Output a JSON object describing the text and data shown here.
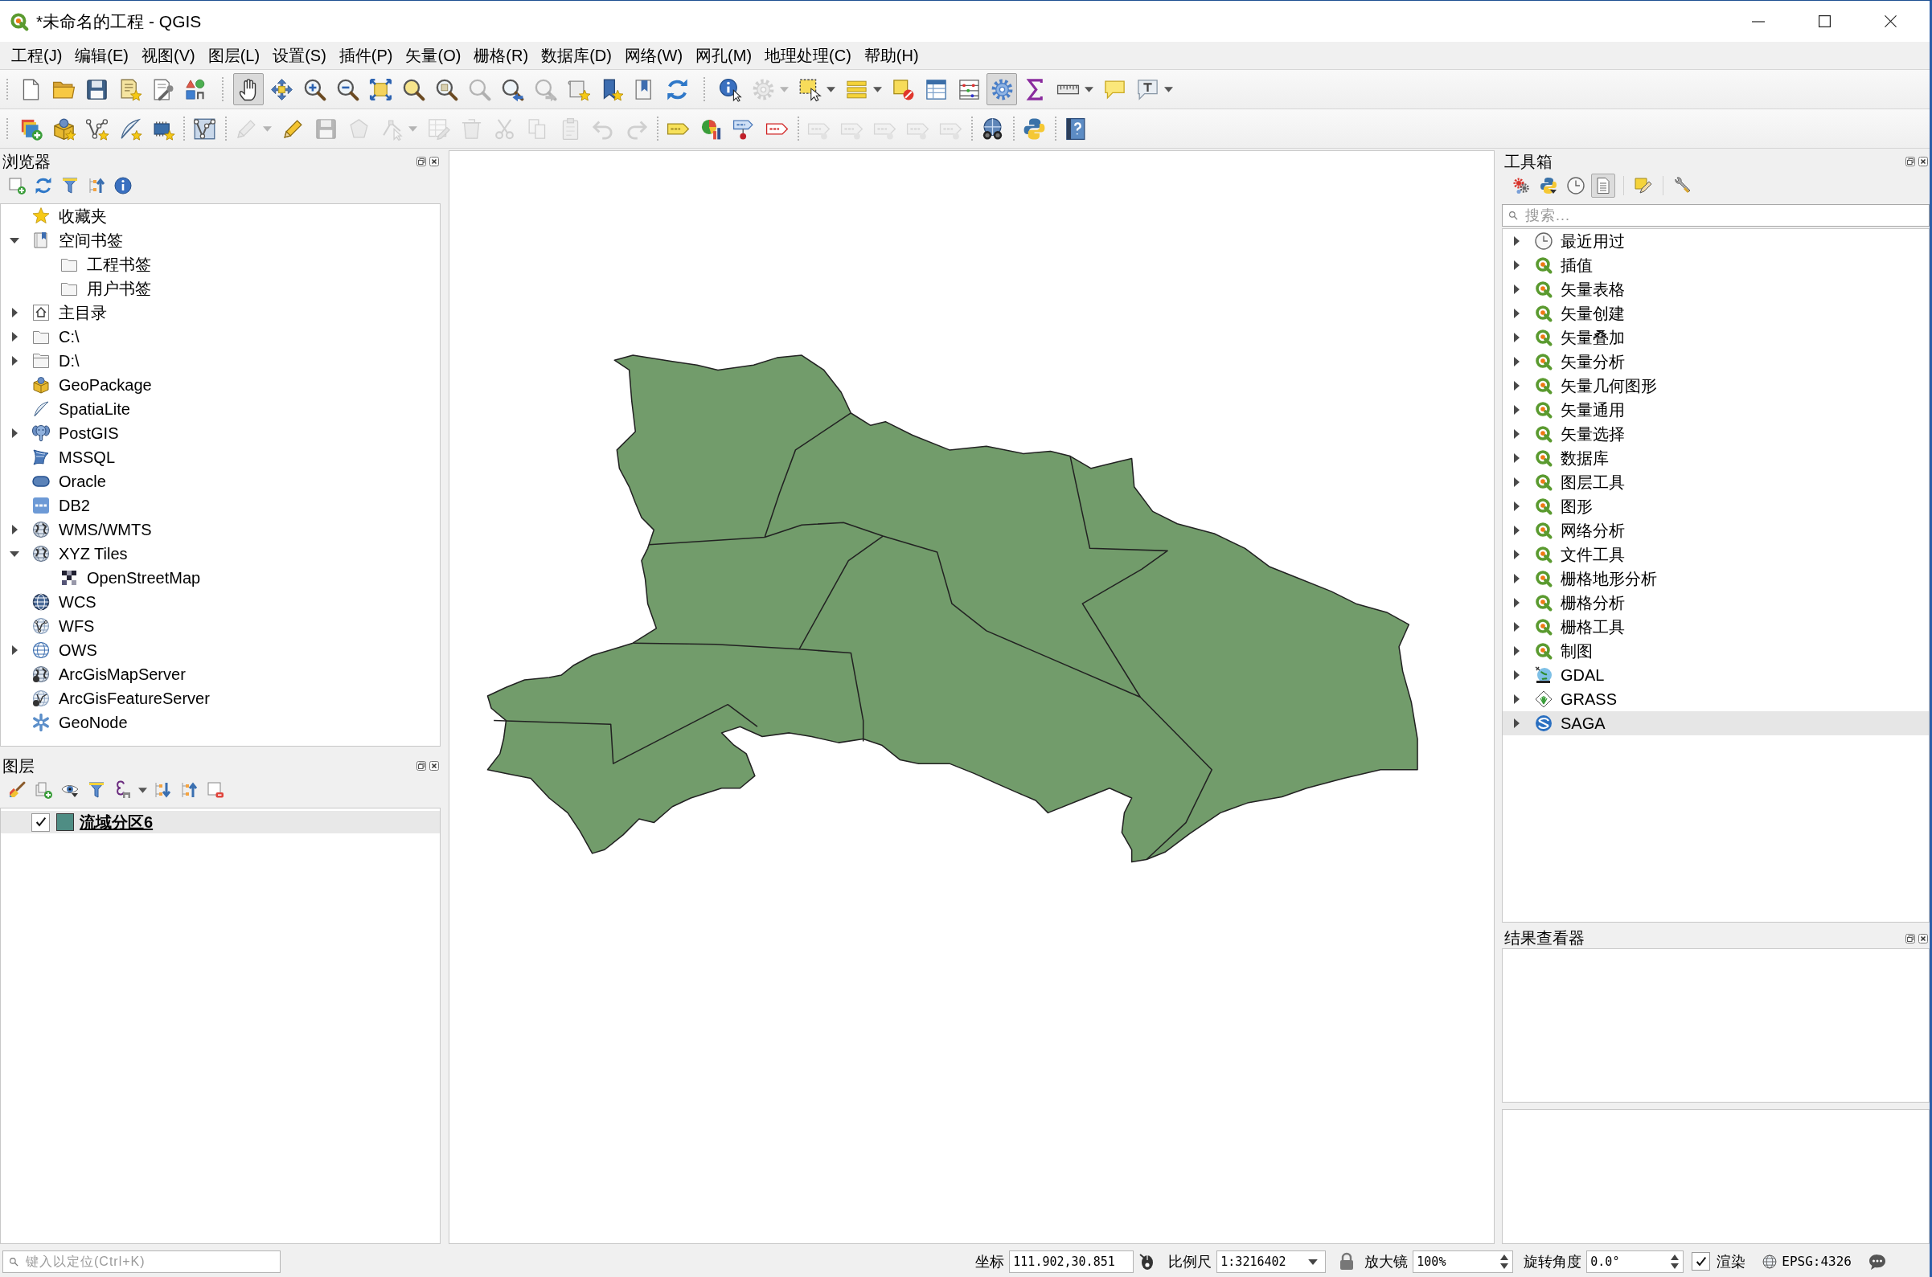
{
  "window": {
    "title": "*未命名的工程 - QGIS"
  },
  "menu": [
    "工程(J)",
    "编辑(E)",
    "视图(V)",
    "图层(L)",
    "设置(S)",
    "插件(P)",
    "矢量(O)",
    "栅格(R)",
    "数据库(D)",
    "网络(W)",
    "网孔(M)",
    "地理处理(C)",
    "帮助(H)"
  ],
  "toolbars": [
    {
      "groups": [
        [
          {
            "kind": "new",
            "selected": false,
            "disabled": false,
            "dropdown": false
          },
          {
            "kind": "open",
            "selected": false,
            "disabled": false,
            "dropdown": false
          },
          {
            "kind": "save",
            "selected": false,
            "disabled": false,
            "dropdown": false
          },
          {
            "kind": "layout-new",
            "selected": false,
            "disabled": false,
            "dropdown": false
          },
          {
            "kind": "layout-manager",
            "selected": false,
            "disabled": false,
            "dropdown": false
          },
          {
            "kind": "style",
            "selected": false,
            "disabled": false,
            "dropdown": false
          }
        ],
        [
          {
            "kind": "pan",
            "selected": true,
            "disabled": false,
            "dropdown": false
          },
          {
            "kind": "pan-select",
            "selected": false,
            "disabled": false,
            "dropdown": false
          },
          {
            "kind": "zoom-in",
            "selected": false,
            "disabled": false,
            "dropdown": false
          },
          {
            "kind": "zoom-out",
            "selected": false,
            "disabled": false,
            "dropdown": false
          },
          {
            "kind": "zoom-full",
            "selected": false,
            "disabled": false,
            "dropdown": false
          },
          {
            "kind": "zoom-selection",
            "selected": false,
            "disabled": false,
            "dropdown": false
          },
          {
            "kind": "zoom-layer",
            "selected": false,
            "disabled": false,
            "dropdown": false
          },
          {
            "kind": "zoom-native",
            "selected": false,
            "disabled": true,
            "dropdown": false
          },
          {
            "kind": "zoom-last",
            "selected": false,
            "disabled": false,
            "dropdown": false
          },
          {
            "kind": "zoom-next",
            "selected": false,
            "disabled": true,
            "dropdown": false
          },
          {
            "kind": "map-new",
            "selected": false,
            "disabled": false,
            "dropdown": false
          },
          {
            "kind": "bookmark-new",
            "selected": false,
            "disabled": false,
            "dropdown": false
          },
          {
            "kind": "bookmarks",
            "selected": false,
            "disabled": false,
            "dropdown": false
          },
          {
            "kind": "refresh",
            "selected": false,
            "disabled": false,
            "dropdown": false
          }
        ],
        [
          {
            "kind": "identify",
            "selected": false,
            "disabled": false,
            "dropdown": false
          },
          {
            "kind": "action",
            "selected": false,
            "disabled": true,
            "dropdown": true
          },
          {
            "kind": "select",
            "selected": false,
            "disabled": false,
            "dropdown": true
          },
          {
            "kind": "select-attr",
            "selected": false,
            "disabled": false,
            "dropdown": true
          },
          {
            "kind": "deselect",
            "selected": false,
            "disabled": false,
            "dropdown": false
          },
          {
            "kind": "table",
            "selected": false,
            "disabled": false,
            "dropdown": false
          },
          {
            "kind": "stats",
            "selected": false,
            "disabled": false,
            "dropdown": false
          },
          {
            "kind": "toolbox",
            "selected": true,
            "disabled": false,
            "dropdown": false
          },
          {
            "kind": "sum",
            "selected": false,
            "disabled": false,
            "dropdown": false
          },
          {
            "kind": "measure",
            "selected": false,
            "disabled": false,
            "dropdown": true
          },
          {
            "kind": "maptip",
            "selected": false,
            "disabled": false,
            "dropdown": false
          },
          {
            "kind": "annotation",
            "selected": false,
            "disabled": false,
            "dropdown": true
          }
        ]
      ]
    },
    {
      "groups": [
        [
          {
            "kind": "dsm",
            "disabled": false,
            "dropdown": false
          },
          {
            "kind": "new-gpkg",
            "disabled": false,
            "dropdown": false
          },
          {
            "kind": "new-shp",
            "disabled": false,
            "dropdown": false
          },
          {
            "kind": "new-spatialite",
            "disabled": false,
            "dropdown": false
          },
          {
            "kind": "new-memory",
            "disabled": false,
            "dropdown": false
          }
        ],
        [
          {
            "kind": "virtual",
            "disabled": false,
            "dropdown": false
          }
        ],
        [
          {
            "kind": "edits",
            "disabled": true,
            "dropdown": true
          },
          {
            "kind": "toggle-edit",
            "disabled": false,
            "dropdown": false
          },
          {
            "kind": "save-edits",
            "disabled": true,
            "dropdown": false
          },
          {
            "kind": "add-feature",
            "disabled": true,
            "dropdown": false
          },
          {
            "kind": "vertex",
            "disabled": true,
            "dropdown": true
          },
          {
            "kind": "modify-attr",
            "disabled": true,
            "dropdown": false
          },
          {
            "kind": "delete",
            "disabled": true,
            "dropdown": false
          },
          {
            "kind": "cut",
            "disabled": true,
            "dropdown": false
          },
          {
            "kind": "copy",
            "disabled": true,
            "dropdown": false
          },
          {
            "kind": "paste",
            "disabled": true,
            "dropdown": false
          },
          {
            "kind": "undo",
            "disabled": true,
            "dropdown": false
          },
          {
            "kind": "redo",
            "disabled": true,
            "dropdown": false
          }
        ],
        [
          {
            "kind": "label",
            "disabled": false,
            "dropdown": false
          },
          {
            "kind": "diagram",
            "disabled": false,
            "dropdown": false
          },
          {
            "kind": "pin",
            "disabled": false,
            "dropdown": false
          },
          {
            "kind": "highlight",
            "disabled": false,
            "dropdown": false
          }
        ],
        [
          {
            "kind": "label-tool",
            "disabled": true,
            "dropdown": false
          },
          {
            "kind": "label-tool",
            "disabled": true,
            "dropdown": false
          },
          {
            "kind": "label-tool",
            "disabled": true,
            "dropdown": false
          },
          {
            "kind": "label-tool",
            "disabled": true,
            "dropdown": false
          },
          {
            "kind": "label-tool",
            "disabled": true,
            "dropdown": false
          }
        ],
        [
          {
            "kind": "metasearch",
            "disabled": false,
            "dropdown": false
          }
        ],
        [
          {
            "kind": "python",
            "disabled": false,
            "dropdown": false
          }
        ],
        [
          {
            "kind": "help",
            "disabled": false,
            "dropdown": false
          }
        ]
      ]
    }
  ],
  "browser": {
    "title": "浏览器",
    "items": [
      {
        "label": "收藏夹",
        "kind": "star"
      },
      {
        "label": "空间书签",
        "kind": "bookmarks",
        "expanded": true,
        "children": [
          {
            "label": "工程书签",
            "kind": "folder"
          },
          {
            "label": "用户书签",
            "kind": "folder"
          }
        ]
      },
      {
        "label": "主目录",
        "kind": "home",
        "expanded": false
      },
      {
        "label": "C:\\",
        "kind": "folder",
        "expanded": false
      },
      {
        "label": "D:\\",
        "kind": "drive",
        "expanded": false
      },
      {
        "label": "GeoPackage",
        "kind": "geopackage"
      },
      {
        "label": "SpatiaLite",
        "kind": "spatialite"
      },
      {
        "label": "PostGIS",
        "kind": "postgis",
        "expanded": false
      },
      {
        "label": "MSSQL",
        "kind": "mssql"
      },
      {
        "label": "Oracle",
        "kind": "oracle"
      },
      {
        "label": "DB2",
        "kind": "db2"
      },
      {
        "label": "WMS/WMTS",
        "kind": "wms",
        "expanded": false
      },
      {
        "label": "XYZ Tiles",
        "kind": "wms",
        "expanded": true,
        "children": [
          {
            "label": "OpenStreetMap",
            "kind": "tiles"
          }
        ]
      },
      {
        "label": "WCS",
        "kind": "wcs"
      },
      {
        "label": "WFS",
        "kind": "wfs"
      },
      {
        "label": "OWS",
        "kind": "ows",
        "expanded": false
      },
      {
        "label": "ArcGisMapServer",
        "kind": "arcgis"
      },
      {
        "label": "ArcGisFeatureServer",
        "kind": "arcgis-feature"
      },
      {
        "label": "GeoNode",
        "kind": "geonode"
      }
    ]
  },
  "layers": {
    "title": "图层",
    "items": [
      {
        "name": "流域分区6",
        "visible": true,
        "selected": true,
        "color": "#4f8d84"
      }
    ]
  },
  "toolbox": {
    "title": "工具箱",
    "tools": [
      [
        {
          "kind": "models",
          "selected": false
        },
        {
          "kind": "scripts",
          "selected": false
        },
        {
          "kind": "history",
          "selected": false
        },
        {
          "kind": "results",
          "selected": true
        }
      ],
      [
        {
          "kind": "edit-in-place",
          "selected": false
        }
      ],
      [
        {
          "kind": "options",
          "selected": false
        }
      ]
    ],
    "search": {
      "placeholder": "搜索..."
    },
    "items": [
      {
        "label": "最近用过",
        "kind": "recent",
        "expanded": false,
        "selected": false
      },
      {
        "label": "插值",
        "kind": "qgis",
        "expanded": false,
        "selected": false
      },
      {
        "label": "矢量表格",
        "kind": "qgis",
        "expanded": false,
        "selected": false
      },
      {
        "label": "矢量创建",
        "kind": "qgis",
        "expanded": false,
        "selected": false
      },
      {
        "label": "矢量叠加",
        "kind": "qgis",
        "expanded": false,
        "selected": false
      },
      {
        "label": "矢量分析",
        "kind": "qgis",
        "expanded": false,
        "selected": false
      },
      {
        "label": "矢量几何图形",
        "kind": "qgis",
        "expanded": false,
        "selected": false
      },
      {
        "label": "矢量通用",
        "kind": "qgis",
        "expanded": false,
        "selected": false
      },
      {
        "label": "矢量选择",
        "kind": "qgis",
        "expanded": false,
        "selected": false
      },
      {
        "label": "数据库",
        "kind": "qgis",
        "expanded": false,
        "selected": false
      },
      {
        "label": "图层工具",
        "kind": "qgis",
        "expanded": false,
        "selected": false
      },
      {
        "label": "图形",
        "kind": "qgis",
        "expanded": false,
        "selected": false
      },
      {
        "label": "网络分析",
        "kind": "qgis",
        "expanded": false,
        "selected": false
      },
      {
        "label": "文件工具",
        "kind": "qgis",
        "expanded": false,
        "selected": false
      },
      {
        "label": "栅格地形分析",
        "kind": "qgis",
        "expanded": false,
        "selected": false
      },
      {
        "label": "栅格分析",
        "kind": "qgis",
        "expanded": false,
        "selected": false
      },
      {
        "label": "栅格工具",
        "kind": "qgis",
        "expanded": false,
        "selected": false
      },
      {
        "label": "制图",
        "kind": "qgis",
        "expanded": false,
        "selected": false
      },
      {
        "label": "GDAL",
        "kind": "gdal",
        "expanded": false,
        "selected": false
      },
      {
        "label": "GRASS",
        "kind": "grass",
        "expanded": false,
        "selected": false
      },
      {
        "label": "SAGA",
        "kind": "saga",
        "expanded": false,
        "selected": true
      }
    ]
  },
  "results": {
    "title": "结果查看器"
  },
  "status_bar": {
    "locate": {
      "placeholder": "键入以定位(Ctrl+K)"
    },
    "coordinate": {
      "label": "坐标",
      "value": "111.902,30.851"
    },
    "scale": {
      "label": "比例尺",
      "value": "1:3216402"
    },
    "magnifier": {
      "label": "放大镜",
      "value": "100%"
    },
    "rotation": {
      "label": "旋转角度",
      "value": "0.0°"
    },
    "render": {
      "label": "渲染",
      "checked": true
    },
    "crs": "EPSG:4326"
  }
}
